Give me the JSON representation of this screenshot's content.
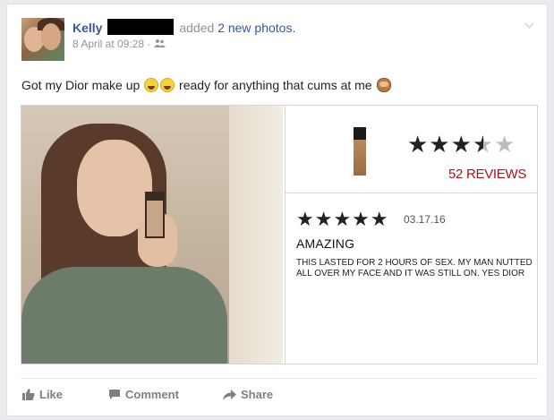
{
  "post": {
    "author_name": "Kelly",
    "action_prefix": "added",
    "action_link": "2 new photos.",
    "timestamp": "8 April at 09:28 ·",
    "privacy_icon": "friends-icon",
    "text_part1": "Got my Dior make up",
    "text_part2": "ready for anything that cums at me"
  },
  "product": {
    "rating": 3.5,
    "rating_max": 5,
    "reviews_label": "52 REVIEWS"
  },
  "review": {
    "rating": 5,
    "date": "03.17.16",
    "title": "AMAZING",
    "body": "THIS LASTED FOR 2 HOURS OF SEX. MY MAN NUTTED ALL OVER MY FACE AND IT WAS STILL ON. YES DIOR"
  },
  "actions": {
    "like": "Like",
    "comment": "Comment",
    "share": "Share"
  },
  "colors": {
    "link": "#365899",
    "reviews_red": "#b0101e"
  }
}
